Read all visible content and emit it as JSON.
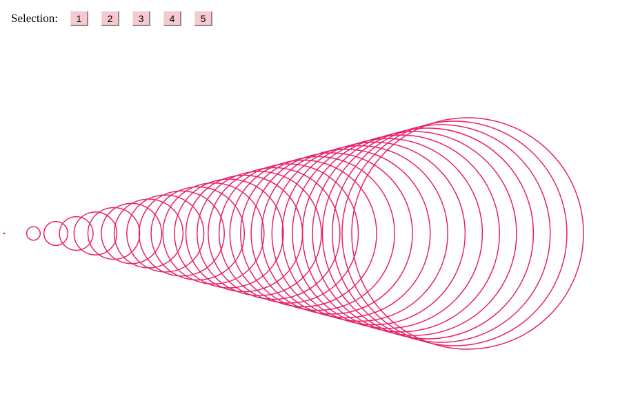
{
  "toolbar": {
    "label": "Selection:",
    "buttons": [
      "1",
      "2",
      "3",
      "4",
      "5"
    ]
  },
  "drawing": {
    "description_type": "cone-of-circles",
    "circle_count": 30,
    "stroke_color": "#e8206a"
  }
}
